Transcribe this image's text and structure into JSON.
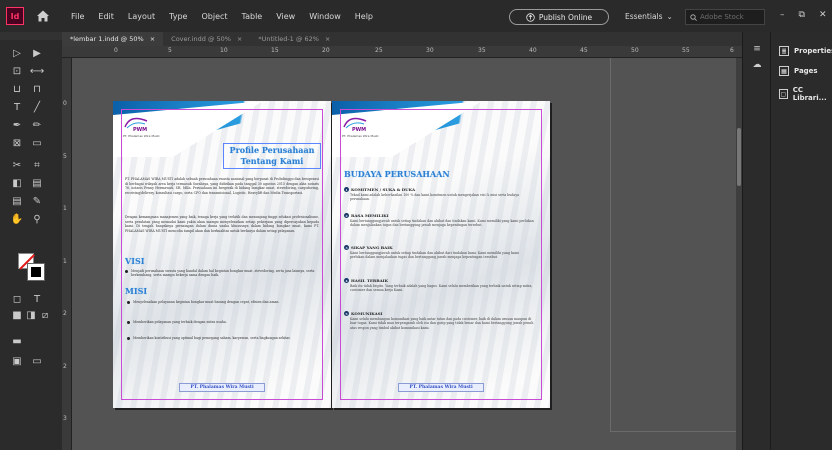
{
  "app": {
    "logo_text": "Id"
  },
  "menu": [
    "File",
    "Edit",
    "Layout",
    "Type",
    "Object",
    "Table",
    "View",
    "Window",
    "Help"
  ],
  "header": {
    "publish_label": "Publish Online",
    "workspace_label": "Essentials",
    "search_placeholder": "Adobe Stock"
  },
  "tabs": [
    {
      "label": "*lembar 1.indd @ 50%",
      "active": true
    },
    {
      "label": "Cover.indd @ 50%",
      "active": false
    },
    {
      "label": "*Untitled-1 @ 62%",
      "active": false
    }
  ],
  "ruler": {
    "h_ticks": [
      "0",
      "5",
      "10",
      "15",
      "20",
      "25",
      "30",
      "35",
      "40",
      "45",
      "50",
      "55",
      "6"
    ],
    "v_ticks": [
      "0",
      "5",
      "1",
      "1",
      "2",
      "2",
      "3"
    ]
  },
  "panels": {
    "items": [
      {
        "label": "Properties",
        "icon": "properties-icon"
      },
      {
        "label": "Pages",
        "icon": "pages-icon"
      },
      {
        "label": "CC Librari...",
        "icon": "cc-libraries-icon"
      }
    ]
  },
  "left_page": {
    "logo_text": "PWM",
    "logo_sub": "PT. Phalamas Wira Musti",
    "title_line1": "Profile Perusahaan",
    "title_line2": "Tentang Kami",
    "intro": "PT. PHALAMAS WIRA MUSTI adalah sebuah perusahaan swasta nasional yang berpusat di Probolinggo dan beroperasi di berbagai wilayah area kerja termasuk Surabaya, yang didirikan pada tanggal 30 agustus 2015 dengan akta notaris 76, notaris Fenny Hermawati, SH, MKn. Perusahaan ini bergerak di bidang bongkar muat, stevedoring, cargodoring, receiving/delivery, konsultasi cargo, serta CFO dan transmisional, Logistic, Heavylift dan Media Transportasi.",
    "intro2": "Dengan kemampuan manajemen yang baik, tenaga kerja yang terlatih dan menunjang tinggi edukasi profesionalisme, serta peralatan yang memadai kami yakin akan mampu menyelesaikan setiap pekerjaan yang dipercayakan kepada kami. Di tengah banyaknya persaingan dalam dunia usaha khususnya dalam bidang bongkar muat, kami PT. PHALAMAS WIRA MUSTI mencoba tampil akan dan berkualitas untuk berkarya dalam setiap pelayanan.",
    "visi_heading": "VISI",
    "visi_text": "Menjadi perusahaan swasta yang handal dalam hal kegiatan bongkar muat, stevedoring, serta jasa lainnya, serta berkembang, serta mampu bekerja sama dengan baik.",
    "misi_heading": "MISI",
    "misi_items": [
      "Menyelesaikan pelayanan kegiatan bongkar muat barang dengan cepat, efisien dan aman.",
      "Memberikan pelayanan yang terbaik dengan mitra usaha.",
      "Memberikan kontribusi yang optimal bagi pemegang saham, karyawan, serta lingkungan sekitar."
    ],
    "footer": "PT. Phalamas Wira Musti"
  },
  "right_page": {
    "logo_text": "PWM",
    "logo_sub": "PT. Phalamas Wira Musti",
    "heading": "BUDAYA PERUSAHAAN",
    "entries": [
      {
        "num": "1",
        "title": "KOMITMEN / SUKA & DUKA",
        "body": "Tekad kami adalah keberhasilan 100 % dan kami komitmen untuk mengerjakan visi & misi serta budaya perusahaan."
      },
      {
        "num": "2",
        "title": "RASA MEMILIKI",
        "body": "Kami bertanggungjawab untuk setiap tindakan dan akibat dan tindakan kami. Kami memiliki yang kami perlukan dalam menjalankan tugas dan bertanggung jawab menjaga kepentingan tersebut."
      },
      {
        "num": "3",
        "title": "SIKAP YANG BAIK",
        "body": "Kami bertanggungjawab untuk setiap tindakan dan akibat dari tindakan kami. Kami memiliki yang kami perlukan dalam menjalankan tugas dan bertanggung jawab menjaga kepentingan tersebut."
      },
      {
        "num": "4",
        "title": "HASIL TERBAIK",
        "body": "Baik itu tidak begitu. Yang terbaik adalah yang bagus. Kami selalu memberikan yang terbaik untuk setiap mitra, customer dan semua kerja Kami."
      },
      {
        "num": "5",
        "title": "KOMUNIKASI",
        "body": "Kami selalu membangun komunikasi yang baik antar tatan dan pada customer, baik di dalam urusan maupun di luar tugas. Kami tidak mau terpengaruh oleh isu dan gosip yang tidak benar dan kami bertanggung jawab penuh atas respon yang timbul akibat komunikasi kami."
      }
    ],
    "footer": "PT. Phalamas Wira Musti"
  }
}
